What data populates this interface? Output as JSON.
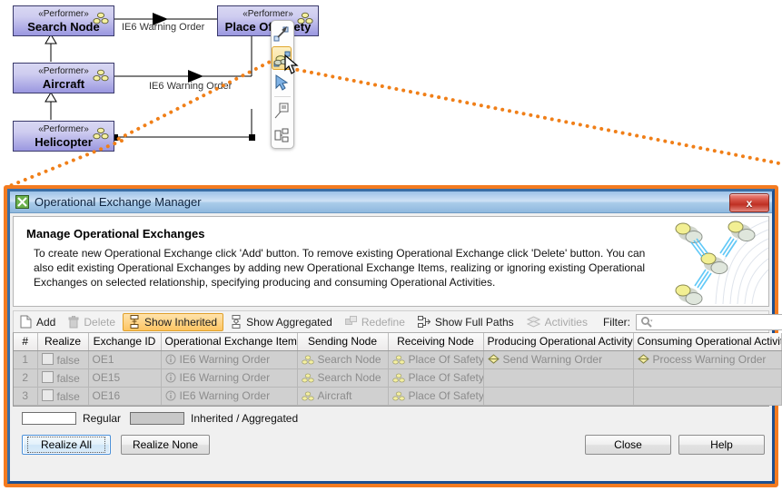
{
  "diagram": {
    "nodes": [
      {
        "stereotype": "«Performer»",
        "name": "Search Node",
        "icon": "performer-icon"
      },
      {
        "stereotype": "«Performer»",
        "name": "Aircraft",
        "icon": "performer-icon"
      },
      {
        "stereotype": "«Performer»",
        "name": "Helicopter",
        "icon": "performer-icon"
      },
      {
        "stereotype": "«Performer»",
        "name": "Place Of Safety",
        "icon": "performer-icon"
      }
    ],
    "edge_labels": [
      "IE6 Warning Order",
      "IE6 Warning Order"
    ],
    "palette": {
      "items": [
        "relation-icon",
        "operational-exchange-manager-icon",
        "select-pointer-icon",
        "note-icon",
        "structure-icon"
      ],
      "selected_index": 1
    }
  },
  "dialog": {
    "title": "Operational Exchange Manager",
    "title_icon": "app-icon",
    "close_label": "x",
    "header": {
      "heading": "Manage Operational Exchanges",
      "description": "To create new Operational Exchange click 'Add' button. To remove existing Operational Exchange click 'Delete' button. You can also edit existing Operational Exchanges by adding new Operational Exchange Items, realizing or ignoring existing Operational Exchanges on selected relationship, specifying producing and consuming Operational Activities."
    },
    "toolbar": {
      "add": "Add",
      "delete": "Delete",
      "show_inherited": "Show Inherited",
      "show_aggregated": "Show Aggregated",
      "redefine": "Redefine",
      "show_full_paths": "Show Full Paths",
      "activities": "Activities",
      "filter_label": "Filter:",
      "filter_value": "",
      "filter_placeholder": ""
    },
    "table": {
      "columns": [
        "#",
        "Realize",
        "Exchange ID",
        "Operational Exchange Item",
        "Sending Node",
        "Receiving Node",
        "Producing Operational Activity",
        "Consuming Operational Activity"
      ],
      "rows": [
        {
          "num": "1",
          "realize": "false",
          "exchange_id": "OE1",
          "exchange_item": "IE6 Warning Order",
          "sending_node": "Search Node",
          "receiving_node": "Place Of Safety",
          "producing_activity": "Send Warning Order",
          "consuming_activity": "Process Warning Order"
        },
        {
          "num": "2",
          "realize": "false",
          "exchange_id": "OE15",
          "exchange_item": "IE6 Warning Order",
          "sending_node": "Search Node",
          "receiving_node": "Place Of Safety",
          "producing_activity": "",
          "consuming_activity": ""
        },
        {
          "num": "3",
          "realize": "false",
          "exchange_id": "OE16",
          "exchange_item": "IE6 Warning Order",
          "sending_node": "Aircraft",
          "receiving_node": "Place Of Safety",
          "producing_activity": "",
          "consuming_activity": ""
        }
      ]
    },
    "legend": {
      "regular": "Regular",
      "inherited": "Inherited / Aggregated"
    },
    "buttons": {
      "realize_all": "Realize All",
      "realize_none": "Realize None",
      "close": "Close",
      "help": "Help"
    }
  },
  "colors": {
    "window_highlight": "#f47b20",
    "node_fill": "#9a97e0",
    "toggle_active": "#fdc563"
  }
}
